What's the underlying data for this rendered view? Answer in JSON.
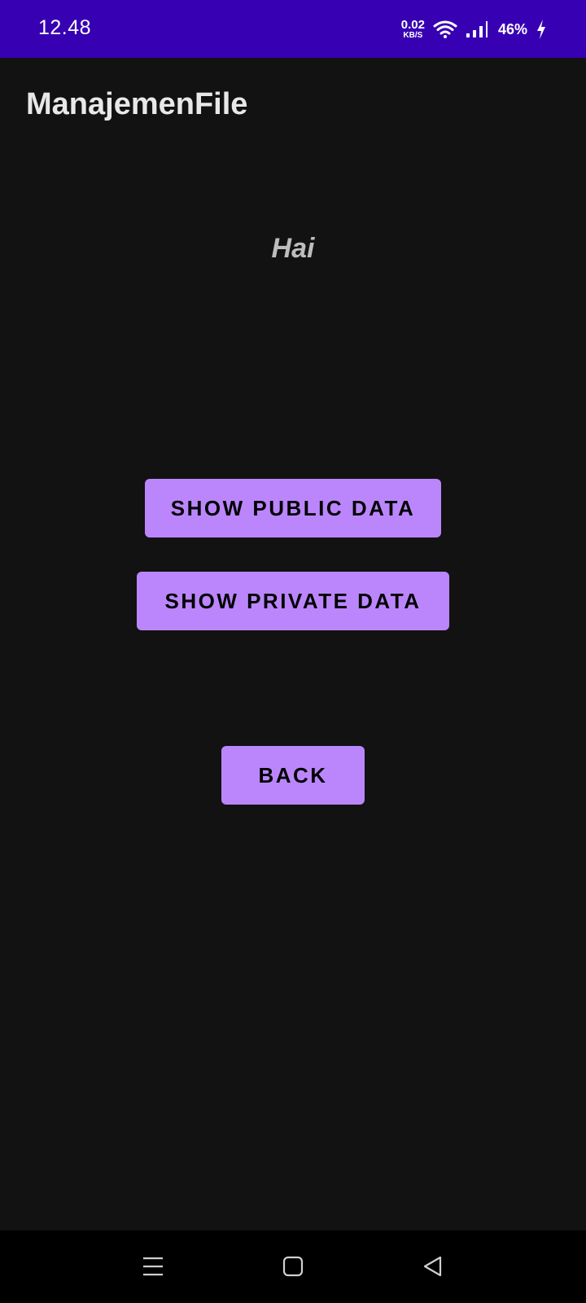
{
  "status_bar": {
    "time": "12.48",
    "net_speed_value": "0.02",
    "net_speed_unit": "KB/S",
    "battery": "46%",
    "icons": [
      "wifi-icon",
      "signal-icon",
      "battery-charging-icon"
    ],
    "background_color": "#3700b3"
  },
  "app_bar": {
    "title": "ManajemenFile"
  },
  "main": {
    "greeting": "Hai",
    "buttons": {
      "show_public": "SHOW PUBLIC DATA",
      "show_private": "SHOW PRIVATE DATA",
      "back": "BACK"
    },
    "button_color": "#bb86fc"
  },
  "nav_bar": {
    "icons": [
      "recent-apps-icon",
      "home-icon",
      "back-icon"
    ]
  }
}
